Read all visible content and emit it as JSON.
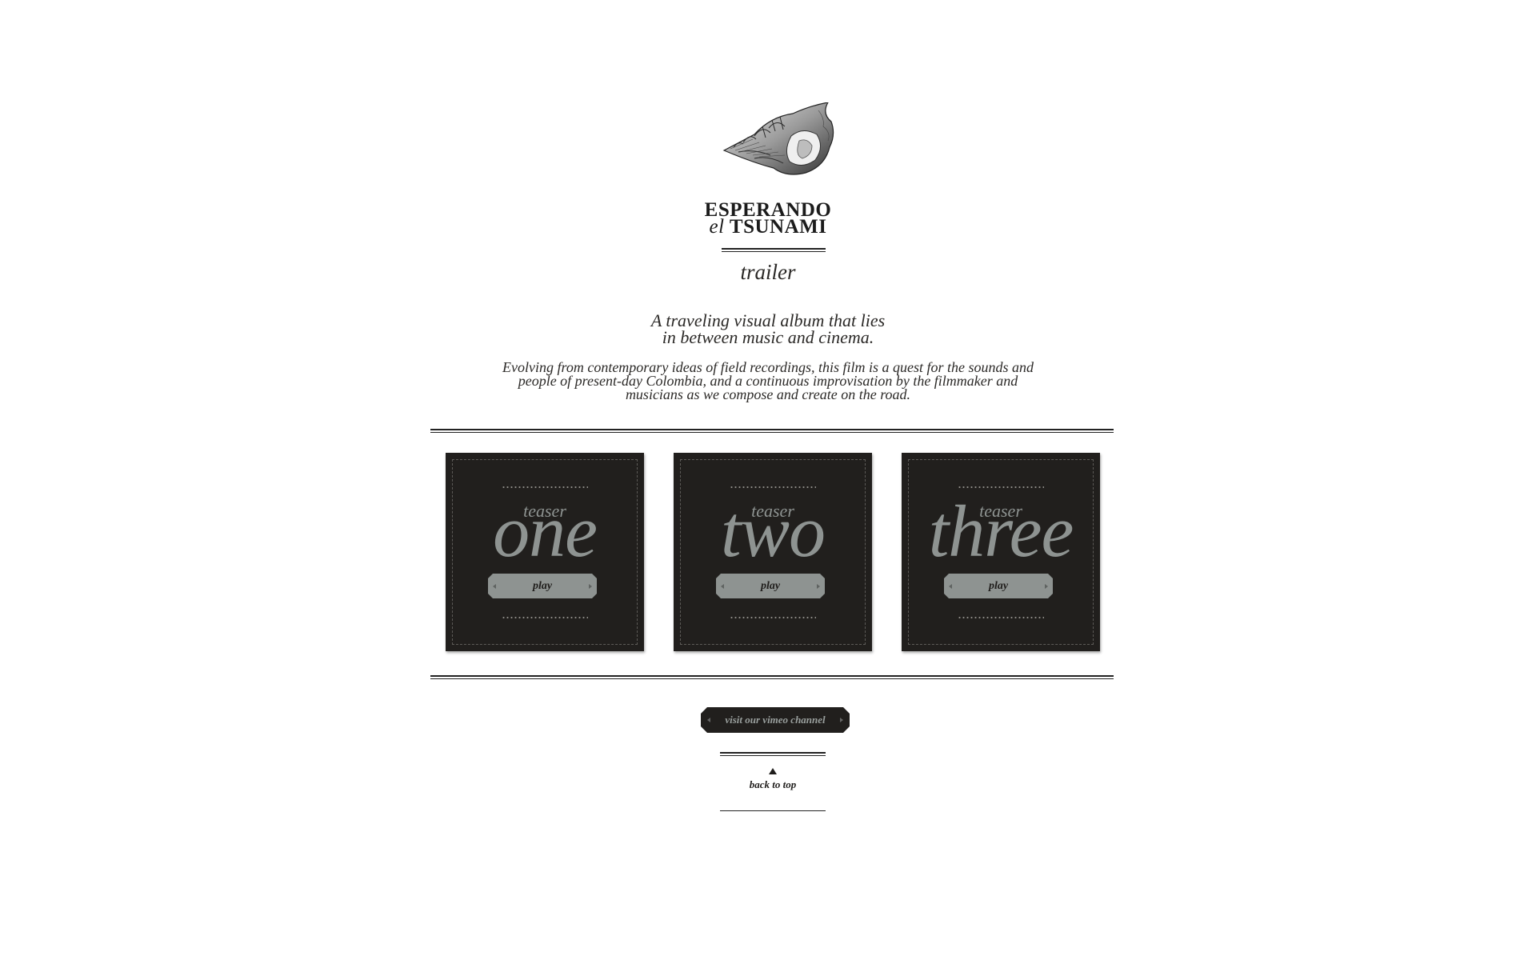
{
  "site": {
    "title_line1": "ESPERANDO",
    "title_el": "el",
    "title_line2": "TSUNAMI",
    "logo_icon": "seashell-illustration"
  },
  "intro": {
    "heading": "trailer",
    "tagline": [
      "A traveling visual album that lies",
      "in between music and cinema."
    ],
    "description": [
      "Evolving from contemporary ideas of field recordings, this film is a quest for the sounds and",
      "people of present-day Colombia, and a continuous improvisation by the filmmaker and",
      "musicians as we compose and create on the road."
    ]
  },
  "teasers": [
    {
      "label": "teaser",
      "word": "one",
      "play_label": "play"
    },
    {
      "label": "teaser",
      "word": "two",
      "play_label": "play"
    },
    {
      "label": "teaser",
      "word": "three",
      "play_label": "play"
    }
  ],
  "footer": {
    "vimeo_label": "visit our vimeo channel",
    "back_to_top": "back to top",
    "back_to_top_icon": "up-triangle-icon"
  },
  "colors": {
    "dark": "#211f1d",
    "accent_grey": "#8e9391",
    "background": "#ffffff"
  }
}
